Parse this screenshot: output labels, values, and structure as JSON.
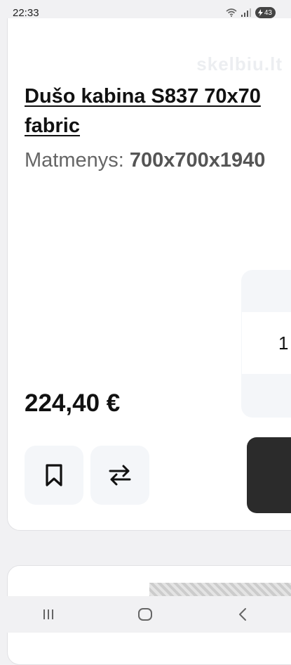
{
  "status": {
    "time": "22:33",
    "battery": "43"
  },
  "watermark": "skelbiu.lt",
  "product": {
    "title": "Dušo kabina S837 70x70 fabric",
    "dimensions_label": "Matmenys:",
    "dimensions_value": "700x700x1940",
    "price": "224,40 €",
    "quantity": "1"
  },
  "icons": {
    "bookmark": "bookmark-icon",
    "swap": "swap-arrows-icon",
    "nav_recent": "recent-apps-icon",
    "nav_home": "home-icon",
    "nav_back": "back-icon"
  }
}
